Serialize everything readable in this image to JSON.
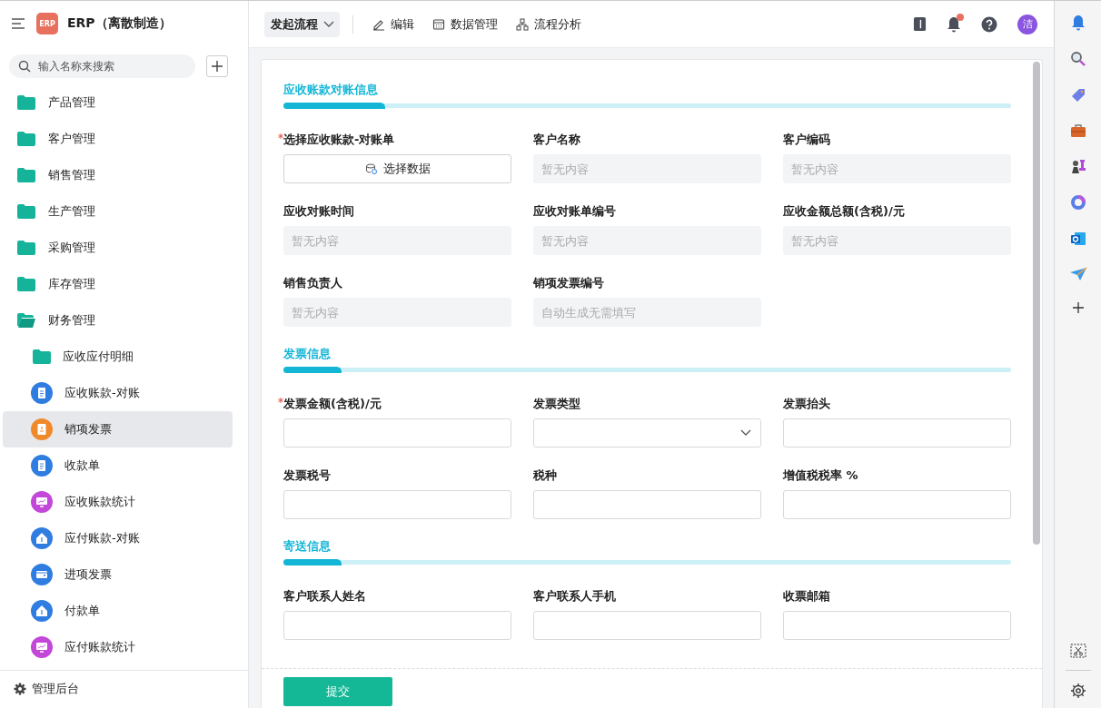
{
  "app": {
    "title": "ERP（离散制造）",
    "logo": "ERP"
  },
  "search": {
    "placeholder": "输入名称来搜索"
  },
  "nav": [
    {
      "label": "产品管理",
      "kind": "folder",
      "selected": false
    },
    {
      "label": "客户管理",
      "kind": "folder",
      "selected": false
    },
    {
      "label": "销售管理",
      "kind": "folder",
      "selected": false
    },
    {
      "label": "生产管理",
      "kind": "folder",
      "selected": false
    },
    {
      "label": "采购管理",
      "kind": "folder",
      "selected": false
    },
    {
      "label": "库存管理",
      "kind": "folder",
      "selected": false
    },
    {
      "label": "财务管理",
      "kind": "folder",
      "selected": false,
      "expanded": true,
      "children": [
        {
          "label": "应收应付明细",
          "kind": "folder",
          "selected": false
        },
        {
          "label": "应收账款-对账",
          "kind": "doc",
          "selected": false
        },
        {
          "label": "销项发票",
          "kind": "form",
          "selected": true
        },
        {
          "label": "收款单",
          "kind": "doc",
          "selected": false
        },
        {
          "label": "应收账款统计",
          "kind": "chart",
          "selected": false
        },
        {
          "label": "应付账款-对账",
          "kind": "house",
          "selected": false
        },
        {
          "label": "进项发票",
          "kind": "card",
          "selected": false
        },
        {
          "label": "付款单",
          "kind": "house",
          "selected": false
        },
        {
          "label": "应付账款统计",
          "kind": "chart",
          "selected": false
        }
      ]
    }
  ],
  "admin": {
    "label": "管理后台"
  },
  "toolbar": {
    "start": "发起流程",
    "actions": [
      {
        "label": "编辑",
        "kind": "edit"
      },
      {
        "label": "数据管理",
        "kind": "table"
      },
      {
        "label": "流程分析",
        "kind": "flow"
      }
    ]
  },
  "header": {
    "notification_badge": true,
    "avatar": "洁"
  },
  "sections": [
    {
      "title": "应收账款对账信息",
      "fields": [
        {
          "label": "选择应收账款-对账单",
          "required": true,
          "kind": "picker",
          "button": "选择数据"
        },
        {
          "label": "客户名称",
          "required": false,
          "kind": "readonly",
          "placeholder": "暂无内容"
        },
        {
          "label": "客户编码",
          "required": false,
          "kind": "readonly",
          "placeholder": "暂无内容"
        },
        {
          "label": "应收对账时间",
          "required": false,
          "kind": "readonly",
          "placeholder": "暂无内容"
        },
        {
          "label": "应收对账单编号",
          "required": false,
          "kind": "readonly",
          "placeholder": "暂无内容"
        },
        {
          "label": "应收金额总额(含税)/元",
          "required": false,
          "kind": "readonly",
          "placeholder": "暂无内容"
        },
        {
          "label": "销售负责人",
          "required": false,
          "kind": "readonly",
          "placeholder": "暂无内容"
        },
        {
          "label": "销项发票编号",
          "required": false,
          "kind": "readonly",
          "placeholder": "自动生成无需填写"
        }
      ]
    },
    {
      "title": "发票信息",
      "fields": [
        {
          "label": "发票金额(含税)/元",
          "required": true,
          "kind": "text"
        },
        {
          "label": "发票类型",
          "required": false,
          "kind": "select"
        },
        {
          "label": "发票抬头",
          "required": false,
          "kind": "text"
        },
        {
          "label": "发票税号",
          "required": false,
          "kind": "text"
        },
        {
          "label": "税种",
          "required": false,
          "kind": "text"
        },
        {
          "label": "增值税税率 %",
          "required": false,
          "kind": "text"
        }
      ]
    },
    {
      "title": "寄送信息",
      "fields": [
        {
          "label": "客户联系人姓名",
          "required": false,
          "kind": "text"
        },
        {
          "label": "客户联系人手机",
          "required": false,
          "kind": "text"
        },
        {
          "label": "收票邮箱",
          "required": false,
          "kind": "text"
        }
      ]
    }
  ],
  "submit": "提交"
}
